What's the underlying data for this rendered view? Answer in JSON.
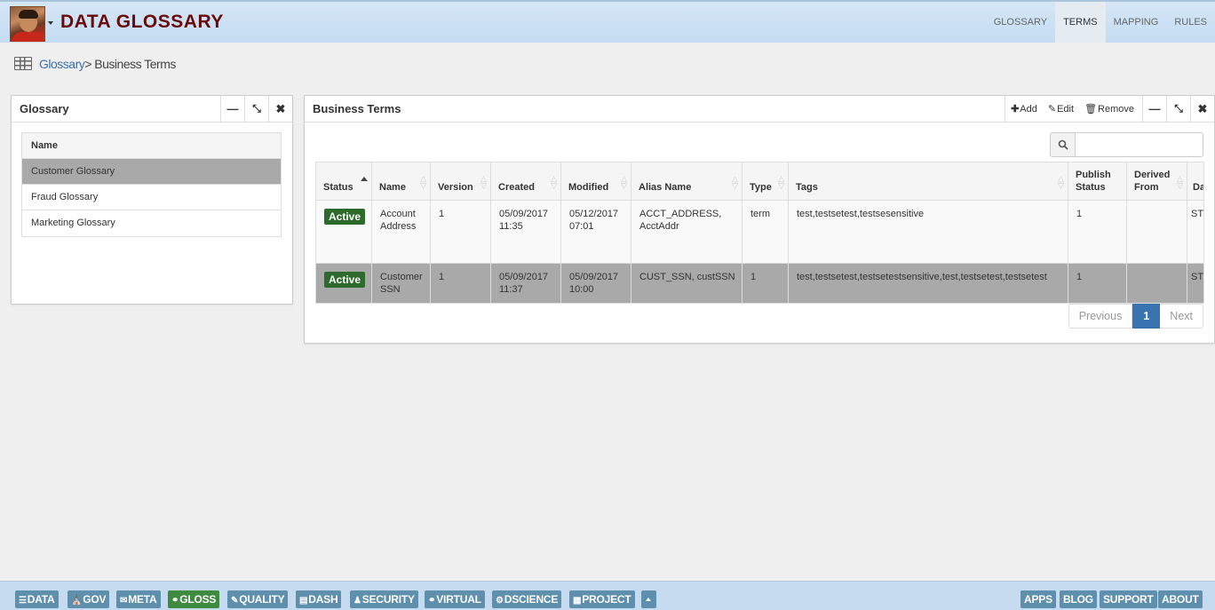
{
  "header": {
    "title": "DATA GLOSSARY",
    "nav": [
      "GLOSSARY",
      "TERMS",
      "MAPPING",
      "RULES"
    ],
    "active_nav": "TERMS"
  },
  "breadcrumb": {
    "link": "Glossary",
    "separator": ">",
    "current": " Business Terms"
  },
  "glossary_panel": {
    "title": "Glossary",
    "column": "Name",
    "items": [
      "Customer Glossary",
      "Fraud Glossary",
      "Marketing Glossary"
    ],
    "selected": "Customer Glossary"
  },
  "terms_panel": {
    "title": "Business Terms",
    "actions": {
      "add": "Add",
      "edit": "Edit",
      "remove": "Remove"
    },
    "search": {
      "value": "",
      "placeholder": ""
    },
    "columns": [
      "Status",
      "Name",
      "Version",
      "Created",
      "Modified",
      "Alias Name",
      "Type",
      "Tags",
      "Publish Status",
      "Derived From",
      "Data Type"
    ],
    "rows": [
      {
        "status": "Active",
        "name": "Account Address",
        "version": "1",
        "created": "05/09/2017 11:35",
        "modified": "05/12/2017 07:01",
        "alias": "ACCT_ADDRESS, AcctAddr",
        "type": "term",
        "tags": "test,testsetest,testsesensitive",
        "publish_status": "1",
        "derived_from": "",
        "data_type": "STRING"
      },
      {
        "status": "Active",
        "name": "Customer SSN",
        "version": "1",
        "created": "05/09/2017 11:37",
        "modified": "05/09/2017 10:00",
        "alias": "CUST_SSN, custSSN",
        "type": "1",
        "tags": "test,testsetest,testsetestsensitive,test,testsetest,testsetest",
        "publish_status": "1",
        "derived_from": "",
        "data_type": "STRING"
      }
    ],
    "pager": {
      "previous": "Previous",
      "current": "1",
      "next": "Next"
    }
  },
  "footer": {
    "left": [
      {
        "label": "DATA",
        "icon": "database-icon"
      },
      {
        "label": "GOV",
        "icon": "bank-icon"
      },
      {
        "label": "META",
        "icon": "envelope-icon"
      },
      {
        "label": "GLOSS",
        "icon": "link-icon"
      },
      {
        "label": "QUALITY",
        "icon": "edit-icon"
      },
      {
        "label": "DASH",
        "icon": "chart-icon"
      },
      {
        "label": "SECURITY",
        "icon": "users-icon"
      },
      {
        "label": "VIRTUAL",
        "icon": "link-icon"
      },
      {
        "label": "DSCIENCE",
        "icon": "cogs-icon"
      },
      {
        "label": "PROJECT",
        "icon": "calendar-icon"
      }
    ],
    "active": "GLOSS",
    "right": [
      "APPS",
      "BLOG",
      "SUPPORT",
      "ABOUT"
    ]
  },
  "colors": {
    "title": "#6b0a0a",
    "active_badge": "#2d6b2d",
    "footer_btn": "#5e8fad",
    "footer_active": "#3e8a3e",
    "pager_current": "#3a74b0"
  }
}
